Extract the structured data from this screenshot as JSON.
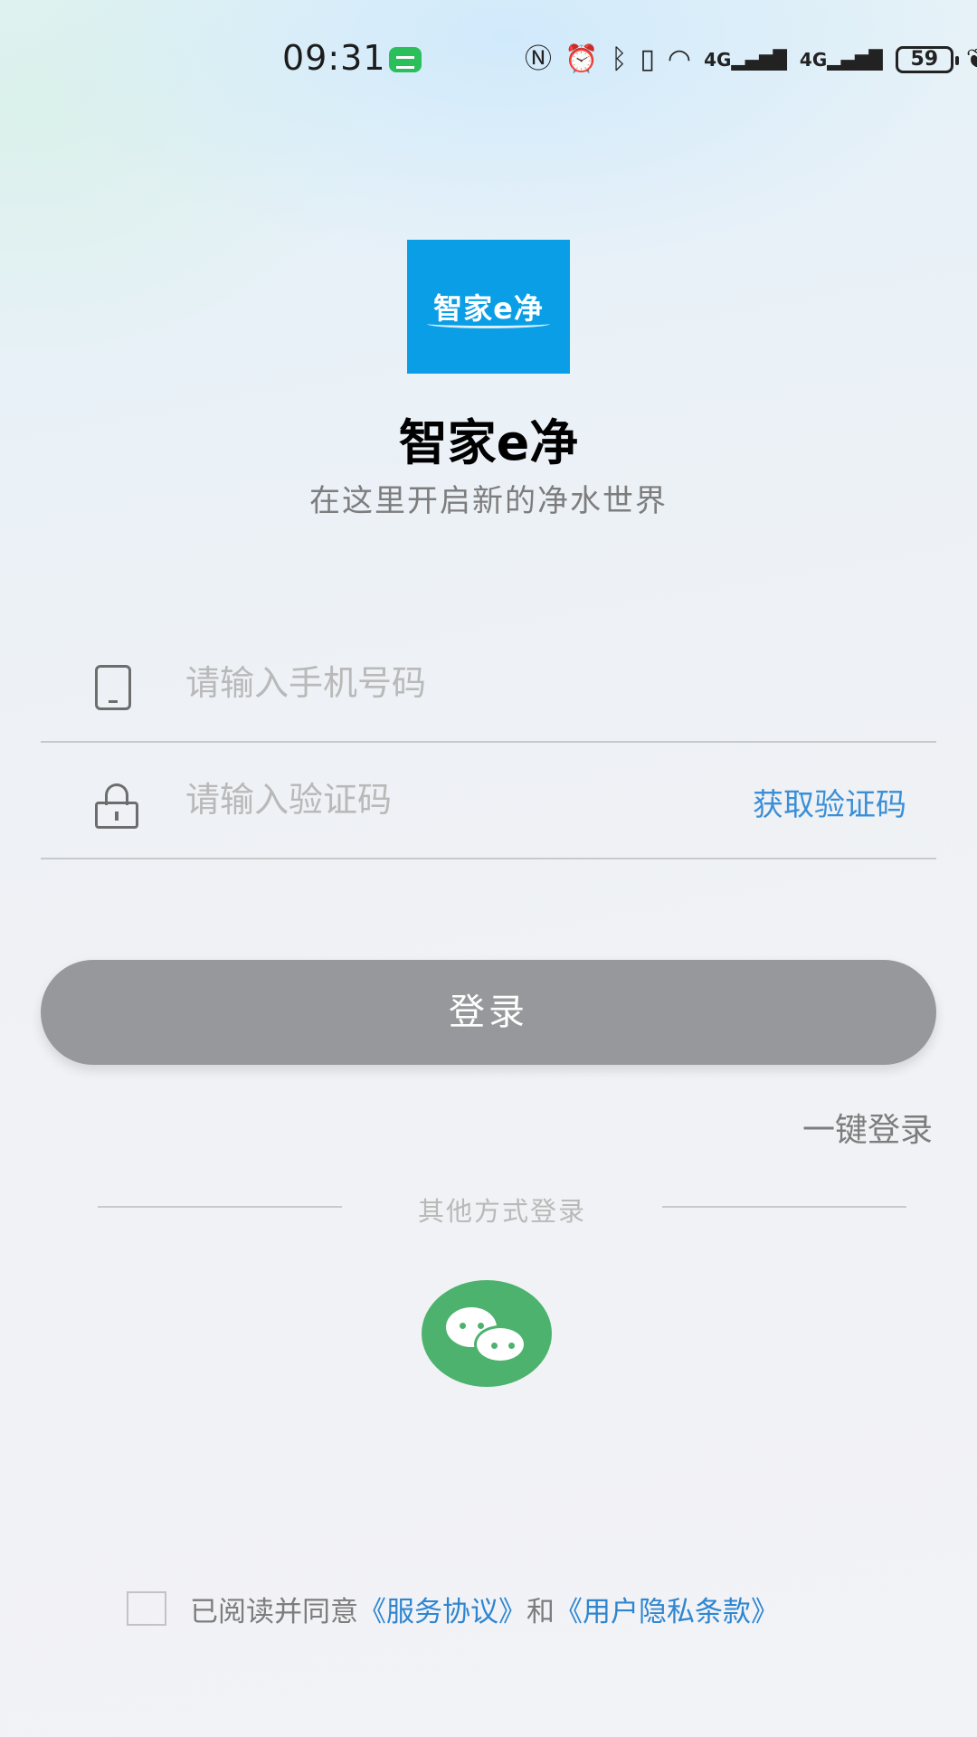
{
  "status_bar": {
    "time": "09:31",
    "battery": "59",
    "icons": [
      "message-icon",
      "nfc-icon",
      "alarm-icon",
      "bluetooth-icon",
      "vibrate-icon",
      "wifi-icon",
      "signal-4g-icon",
      "signal-4g-icon",
      "battery-icon",
      "leaf-icon"
    ]
  },
  "app": {
    "logo_text": "智家e净",
    "title": "智家e净",
    "subtitle": "在这里开启新的净水世界"
  },
  "form": {
    "phone_placeholder": "请输入手机号码",
    "code_placeholder": "请输入验证码",
    "get_code_label": "获取验证码",
    "login_label": "登录",
    "one_key_login": "一键登录"
  },
  "other_login": {
    "label": "其他方式登录",
    "options": [
      "wechat"
    ]
  },
  "agreement": {
    "prefix": "已阅读并同意",
    "service_link": "《服务协议》",
    "conjunction": "和",
    "privacy_link": "《用户隐私条款》",
    "checked": false
  },
  "colors": {
    "brand_blue": "#0a9ee6",
    "link_blue": "#3c8fd6",
    "button_gray": "#97989b",
    "wechat_green": "#4db26e"
  }
}
